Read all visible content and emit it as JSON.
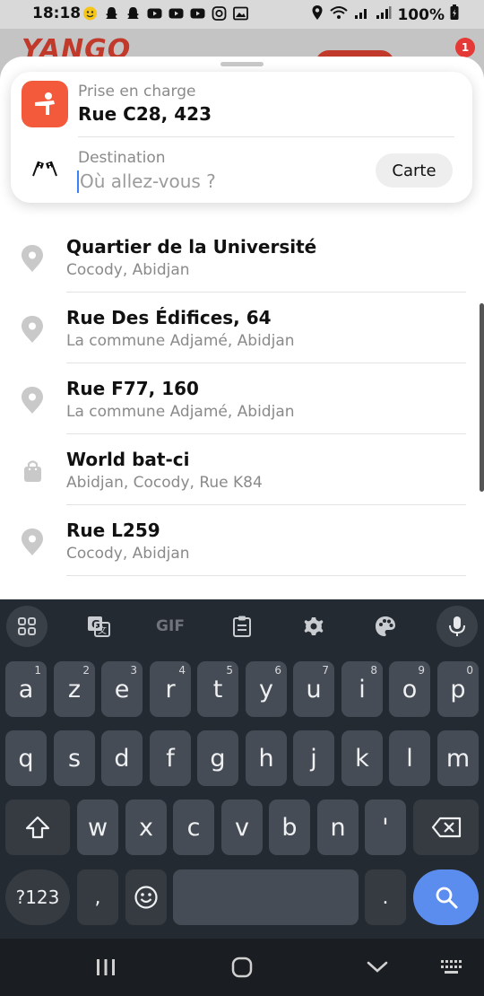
{
  "status_bar": {
    "time": "18:18",
    "battery": "100%"
  },
  "app": {
    "logo": "YANGO",
    "notification_count": "1"
  },
  "route": {
    "pickup_label": "Prise en charge",
    "pickup_value": "Rue C28, 423",
    "destination_label": "Destination",
    "destination_placeholder": "Où allez-vous ?",
    "map_button": "Carte"
  },
  "suggestions": [
    {
      "icon": "location-pin-icon",
      "title": "Quartier de la Université",
      "subtitle": "Cocody, Abidjan"
    },
    {
      "icon": "location-pin-icon",
      "title": "Rue Des Édifices, 64",
      "subtitle": "La commune Adjamé, Abidjan"
    },
    {
      "icon": "location-pin-icon",
      "title": "Rue F77, 160",
      "subtitle": "La commune Adjamé, Abidjan"
    },
    {
      "icon": "shopping-bag-icon",
      "title": "World bat-ci",
      "subtitle": "Abidjan, Cocody, Rue K84"
    },
    {
      "icon": "location-pin-icon",
      "title": "Rue L259",
      "subtitle": "Cocody, Abidjan"
    }
  ],
  "keyboard": {
    "toolbar": [
      "apps-grid-icon",
      "translate-icon",
      "gif-icon",
      "clipboard-icon",
      "settings-icon",
      "palette-icon",
      "microphone-icon"
    ],
    "gif_label": "GIF",
    "row1": [
      {
        "key": "a",
        "hint": "1"
      },
      {
        "key": "z",
        "hint": "2"
      },
      {
        "key": "e",
        "hint": "3"
      },
      {
        "key": "r",
        "hint": "4"
      },
      {
        "key": "t",
        "hint": "5"
      },
      {
        "key": "y",
        "hint": "6"
      },
      {
        "key": "u",
        "hint": "7"
      },
      {
        "key": "i",
        "hint": "8"
      },
      {
        "key": "o",
        "hint": "9"
      },
      {
        "key": "p",
        "hint": "0"
      }
    ],
    "row2": [
      "q",
      "s",
      "d",
      "f",
      "g",
      "h",
      "j",
      "k",
      "l",
      "m"
    ],
    "row3": [
      "w",
      "x",
      "c",
      "v",
      "b",
      "n",
      "'"
    ],
    "symbols_key": "?123",
    "comma_key": ",",
    "period_key": "."
  }
}
